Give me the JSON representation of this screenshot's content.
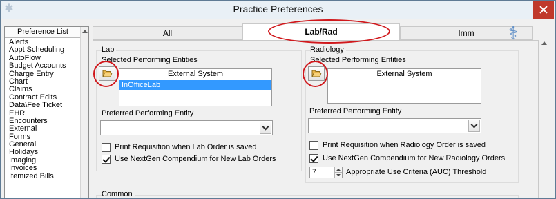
{
  "window": {
    "title": "Practice Preferences",
    "app_icon": "star-of-life-icon",
    "close_icon": "close-icon"
  },
  "sidebar": {
    "header": "Preference List",
    "items": [
      "Alerts",
      "Appt Scheduling",
      "AutoFlow",
      "Budget Accounts",
      "Charge Entry",
      "Chart",
      "Claims",
      "Contract Edits",
      "Data\\Fee Ticket",
      "EHR",
      "Encounters",
      "External",
      "Forms",
      "General",
      "Holidays",
      "Imaging",
      "Invoices",
      "Itemized Bills"
    ]
  },
  "tabs": {
    "all": "All",
    "labrad": "Lab/Rad",
    "imm": "Imm",
    "active": "labrad"
  },
  "lab": {
    "group_title": "Lab",
    "selected_label": "Selected Performing Entities",
    "table_header": "External System",
    "rows": [
      "InOfficeLab"
    ],
    "preferred_label": "Preferred Performing Entity",
    "preferred_value": "",
    "print_requisition_label": "Print Requisition when Lab Order is saved",
    "print_requisition_checked": false,
    "compendium_label": "Use NextGen Compendium for New Lab Orders",
    "compendium_checked": true
  },
  "radiology": {
    "group_title": "Radiology",
    "selected_label": "Selected Performing Entities",
    "table_header": "External System",
    "rows": [],
    "preferred_label": "Preferred Performing Entity",
    "preferred_value": "",
    "print_requisition_label": "Print Requisition when Radiology Order is saved",
    "print_requisition_checked": false,
    "compendium_label": "Use NextGen Compendium for New Radiology Orders",
    "compendium_checked": true,
    "auc_value": "7",
    "auc_label": "Appropriate Use Criteria (AUC) Threshold"
  },
  "common": {
    "group_title": "Common"
  },
  "colors": {
    "annotation": "#d0181c",
    "selection": "#3399ff",
    "close_button": "#c0392b"
  }
}
